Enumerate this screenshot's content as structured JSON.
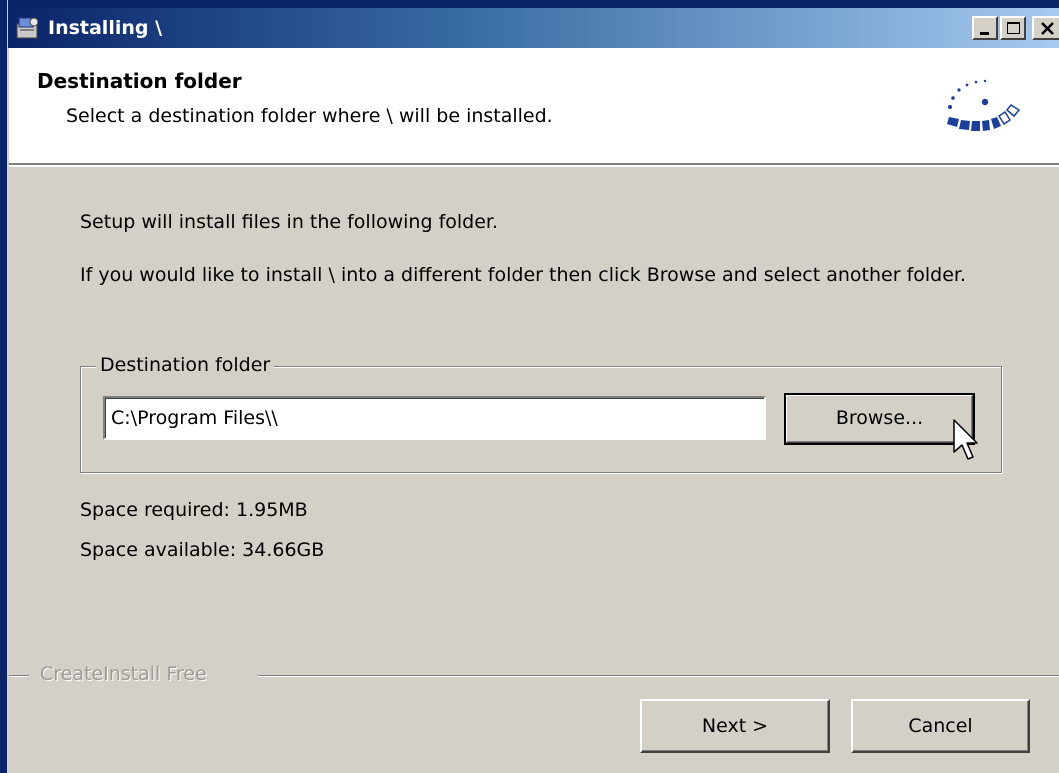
{
  "window": {
    "title": "Installing \\",
    "icon": "installer-icon"
  },
  "header": {
    "title": "Destination folder",
    "subtitle": "Select a destination folder where \\ will be installed.",
    "logo": "createinstall-logo"
  },
  "body": {
    "intro": "Setup will install files in the following folder.",
    "instructions": "If you would like to install \\ into a different folder then click Browse and select another folder."
  },
  "destination": {
    "group_label": "Destination folder",
    "path_value": "C:\\Program Files\\\\",
    "browse_label": "Browse..."
  },
  "space": {
    "required": "Space required: 1.95MB",
    "available": "Space available: 34.66GB"
  },
  "footer": {
    "brand": "CreateInstall Free",
    "next_label": "Next >",
    "cancel_label": "Cancel"
  },
  "colors": {
    "titlebar_start": "#0a246a",
    "titlebar_end": "#a6caf0",
    "face": "#d4d0c8",
    "logo_blue": "#1a3f9c"
  }
}
